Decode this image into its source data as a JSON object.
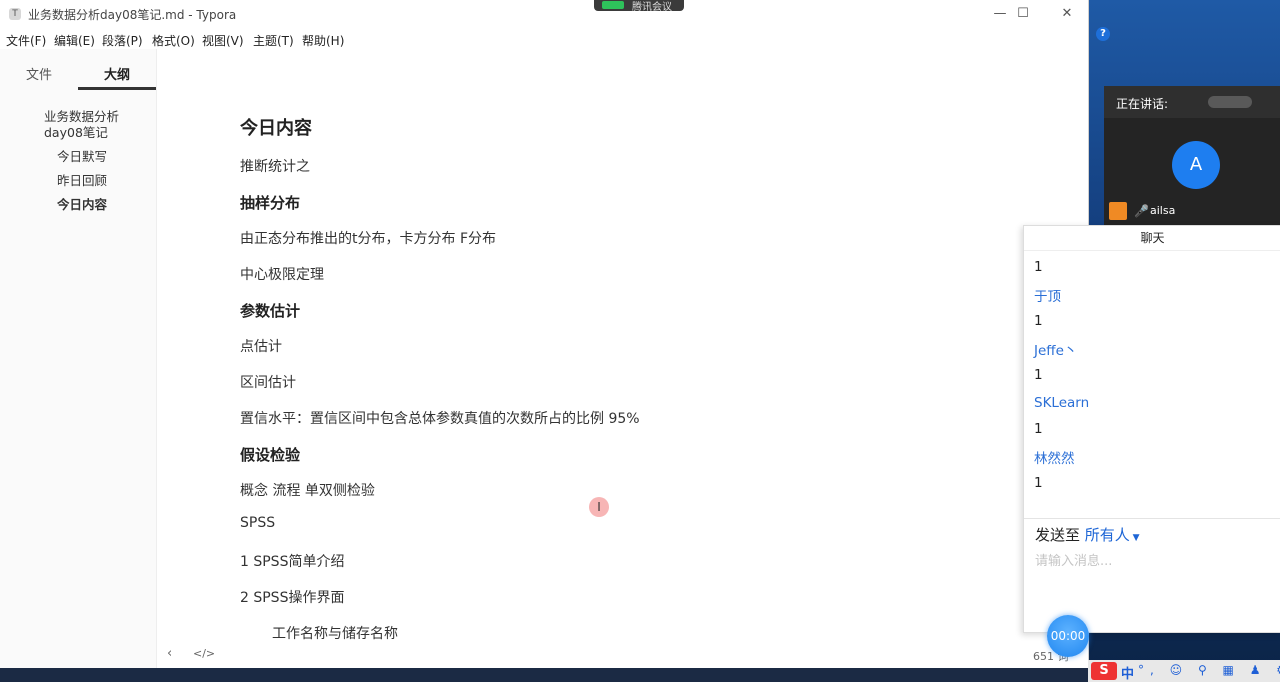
{
  "window": {
    "title": "业务数据分析day08笔记.md - Typora",
    "app_icon": "T"
  },
  "menu": [
    "文件(F)",
    "编辑(E)",
    "段落(P)",
    "格式(O)",
    "视图(V)",
    "主题(T)",
    "帮助(H)"
  ],
  "sidebar": {
    "tabs": [
      "文件",
      "大纲"
    ],
    "active_tab": "大纲",
    "outline": [
      "业务数据分析",
      "day08笔记",
      "今日默写",
      "昨日回顾",
      "今日内容"
    ]
  },
  "document": {
    "lines": [
      "今日内容",
      "推断统计之",
      "抽样分布",
      "由正态分布推出的t分布，卡方分布 F分布",
      "中心极限定理",
      "参数估计",
      "点估计",
      "区间估计",
      "置信水平：置信区间中包含总体参数真值的次数所占的比例 95%",
      "假设检验",
      "概念 流程 单双侧检验",
      "SPSS",
      "1 SPSS简单介绍",
      "2 SPSS操作界面",
      "工作名称与储存名称"
    ]
  },
  "statusbar": {
    "back": "‹",
    "code": "</>",
    "word_count": "651 词"
  },
  "meeting": {
    "app_name": "腾讯会议",
    "speaking_label": "正在讲话:",
    "avatar_letter": "A",
    "speaker_name": "ailsa",
    "chat_title": "聊天",
    "messages": [
      {
        "type": "text",
        "value": "1"
      },
      {
        "type": "name",
        "value": "于顶"
      },
      {
        "type": "text",
        "value": "1"
      },
      {
        "type": "name",
        "value": "Jeffe丶"
      },
      {
        "type": "text",
        "value": "1"
      },
      {
        "type": "name",
        "value": "SKLearn"
      },
      {
        "type": "text",
        "value": "1"
      },
      {
        "type": "name",
        "value": "林然然"
      },
      {
        "type": "text",
        "value": "1"
      }
    ],
    "send_to_label": "发送至",
    "send_to_value": "所有人",
    "input_placeholder": "请输入消息...",
    "timer": "00:00"
  },
  "ime": {
    "logo": "S",
    "mode": "中"
  }
}
